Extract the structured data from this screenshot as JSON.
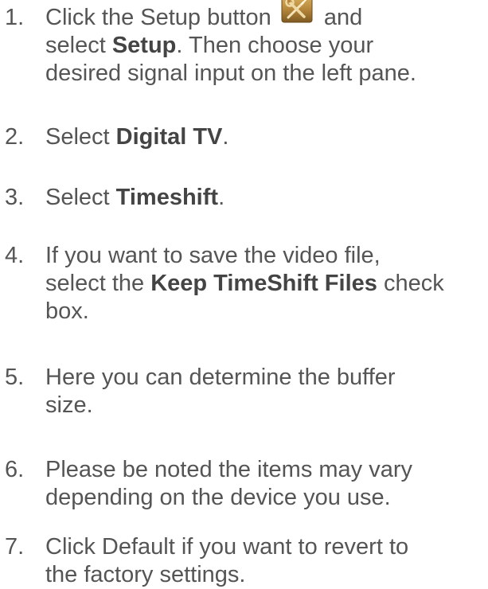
{
  "steps": [
    {
      "number": "1.",
      "line1_pre": "Click the Setup button",
      "line1_post": "and",
      "line2_pre": "select ",
      "line2_bold": "Setup",
      "line2_post": ". Then choose your",
      "line3": "desired signal input on the left pane.",
      "icon": "setup-tools-icon"
    },
    {
      "number": "2.",
      "pre": "Select ",
      "bold": "Digital TV",
      "post": "."
    },
    {
      "number": "3.",
      "pre": "Select ",
      "bold": "Timeshift",
      "post": "."
    },
    {
      "number": "4.",
      "line1": "If you want to save the video file,",
      "line2_pre": "select the ",
      "line2_bold": "Keep TimeShift Files",
      "line2_post": " check",
      "line3": "box."
    },
    {
      "number": "5.",
      "line1": "Here you can determine the buffer",
      "line2": "size."
    },
    {
      "number": "6.",
      "line1": "Please be noted the items may vary",
      "line2": "depending on the device you use."
    },
    {
      "number": "7.",
      "line1": "Click Default if you want to revert to",
      "line2": "the factory settings."
    }
  ],
  "colors": {
    "text": "#555555",
    "bold": "#444444",
    "icon_bg": "#b98a3c"
  }
}
